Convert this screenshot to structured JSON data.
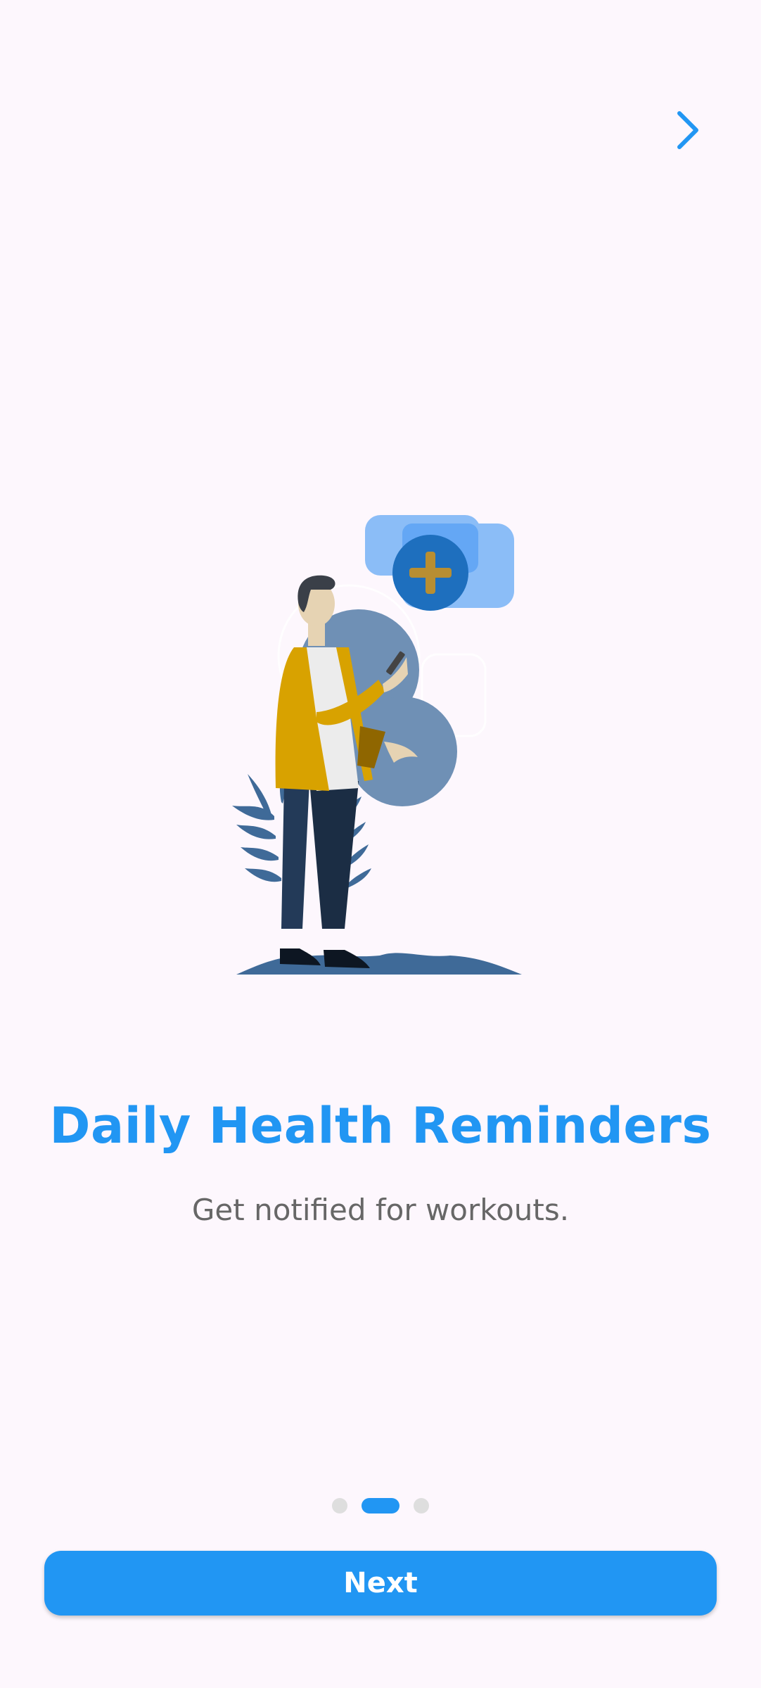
{
  "header": {
    "skip_icon": "chevron-right-icon"
  },
  "onboarding": {
    "illustration": "person-with-phone-health-reminder-illustration",
    "title": "Daily Health Reminders",
    "subtitle": "Get notified for workouts.",
    "page_indicator": {
      "total": 3,
      "current": 2
    }
  },
  "footer": {
    "next_label": "Next"
  },
  "colors": {
    "background": "#fdf7fd",
    "accent": "#2196f3",
    "subtitle": "#676767",
    "inactive_dot": "#dedede"
  }
}
